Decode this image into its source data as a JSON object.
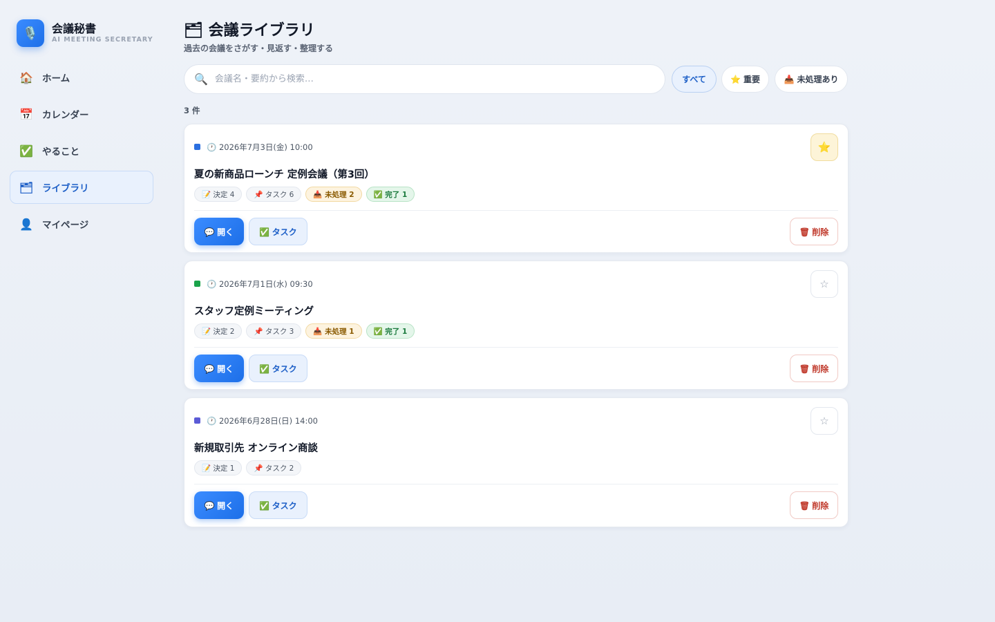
{
  "brand": {
    "title": "会議秘書",
    "subtitle": "AI MEETING SECRETARY",
    "logo_icon": "🎙️"
  },
  "nav": [
    {
      "icon": "🏠",
      "label": "ホーム"
    },
    {
      "icon": "📅",
      "label": "カレンダー"
    },
    {
      "icon": "✅",
      "label": "やること"
    },
    {
      "icon": "🗂",
      "label": "ライブラリ",
      "active": true
    },
    {
      "icon": "👤",
      "label": "マイページ"
    }
  ],
  "page": {
    "title": "🗂 会議ライブラリ",
    "subtitle": "過去の会議をさがす・見返す・整理する"
  },
  "search": {
    "icon": "🔍",
    "placeholder": "会議名・要約から検索…",
    "value": ""
  },
  "filters": {
    "all": "すべて",
    "important": "⭐ 重要",
    "pending": "📥 未処理あり"
  },
  "count": "3 件",
  "meetings": [
    {
      "color": "#2b6fe0",
      "date": "🕐 2026年7月3日(金) 10:00",
      "title": "夏の新商品ローンチ 定例会議（第3回）",
      "starred": true,
      "star": "⭐",
      "decisions": "📝 決定 4",
      "tasks": "📌 タスク 6",
      "pending": "📥 未処理 2",
      "done": "✅ 完了 1"
    },
    {
      "color": "#1aa34a",
      "date": "🕐 2026年7月1日(水) 09:30",
      "title": "スタッフ定例ミーティング",
      "starred": false,
      "star": "☆",
      "decisions": "📝 決定 2",
      "tasks": "📌 タスク 3",
      "pending": "📥 未処理 1",
      "done": "✅ 完了 1"
    },
    {
      "color": "#5b5bd6",
      "date": "🕐 2026年6月28日(日) 14:00",
      "title": "新規取引先 オンライン商談",
      "starred": false,
      "star": "☆",
      "decisions": "📝 決定 1",
      "tasks": "📌 タスク 2"
    }
  ],
  "actions": {
    "open": "💬 開く",
    "task": "✅ タスク",
    "delete": "🗑 削除"
  }
}
